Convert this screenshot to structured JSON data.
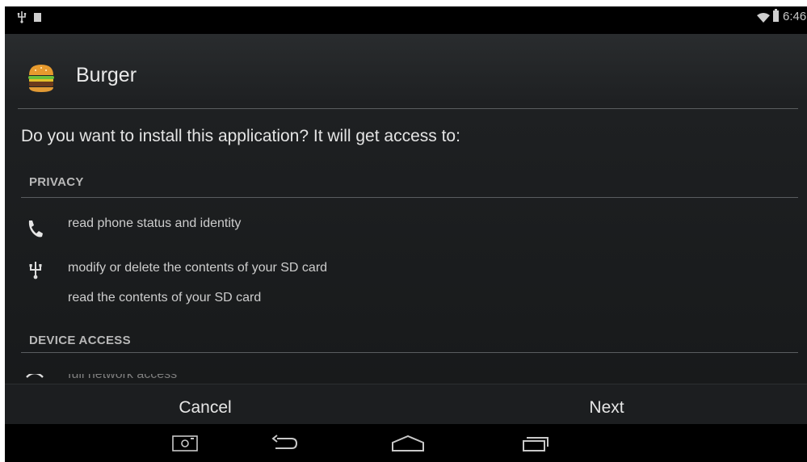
{
  "status_bar": {
    "time": "6:46",
    "icons": [
      "usb-icon",
      "notification-icon",
      "wifi-icon",
      "battery-icon"
    ]
  },
  "app": {
    "name": "Burger",
    "icon": "burger-icon"
  },
  "install_prompt": "Do you want to install this application? It will get access to:",
  "sections": {
    "privacy": {
      "header": "PRIVACY",
      "permissions": [
        {
          "icon": "phone-icon",
          "text": "read phone status and identity"
        },
        {
          "icon": "usb-icon",
          "text": "modify or delete the contents of your SD card"
        },
        {
          "icon": "",
          "text": "read the contents of your SD card"
        }
      ]
    },
    "device_access": {
      "header": "DEVICE ACCESS",
      "permissions": [
        {
          "icon": "network-icon",
          "text": "full network access"
        }
      ]
    }
  },
  "buttons": {
    "cancel": "Cancel",
    "next": "Next"
  },
  "nav_bar": [
    "screenshot-icon",
    "back-icon",
    "home-icon",
    "recents-icon"
  ],
  "colors": {
    "background": "#1e2022",
    "divider": "#5a5d60",
    "text_primary": "#e4e4e4",
    "status_bar": "#000000"
  }
}
